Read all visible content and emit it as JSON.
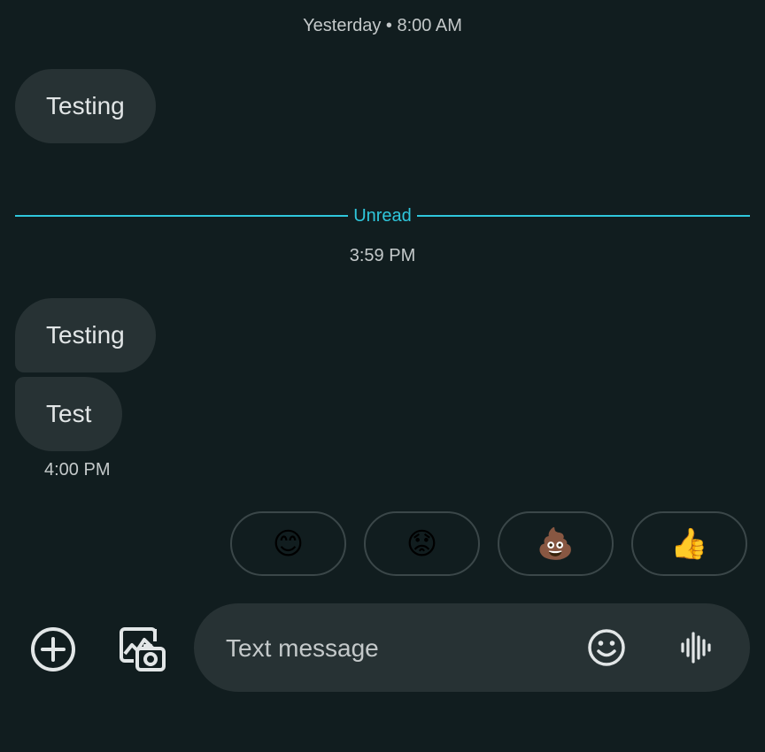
{
  "conversation": {
    "header_timestamp": "Yesterday • 8:00 AM",
    "messages_before": [
      {
        "text": "Testing"
      }
    ],
    "unread_label": "Unread",
    "unread_timestamp": "3:59 PM",
    "messages_after": [
      {
        "text": "Testing"
      },
      {
        "text": "Test"
      }
    ],
    "last_message_time": "4:00 PM"
  },
  "quick_reactions": [
    {
      "emoji": "😊",
      "icon": "smiling-face-emoji"
    },
    {
      "emoji": "😟",
      "icon": "worried-face-emoji"
    },
    {
      "emoji": "💩",
      "icon": "pile-of-poo-emoji"
    },
    {
      "emoji": "👍",
      "icon": "thumbs-up-emoji"
    }
  ],
  "composer": {
    "placeholder": "Text message",
    "value": "",
    "attach_icon": "add-circle-icon",
    "gallery_icon": "gallery-camera-icon",
    "emoji_icon": "emoji-smiley-icon",
    "voice_icon": "voice-waveform-icon"
  },
  "colors": {
    "background": "#111d1f",
    "bubble": "#273234",
    "accent": "#2fc7dc",
    "text": "#e2e6e7",
    "muted": "#c4c9ca"
  }
}
